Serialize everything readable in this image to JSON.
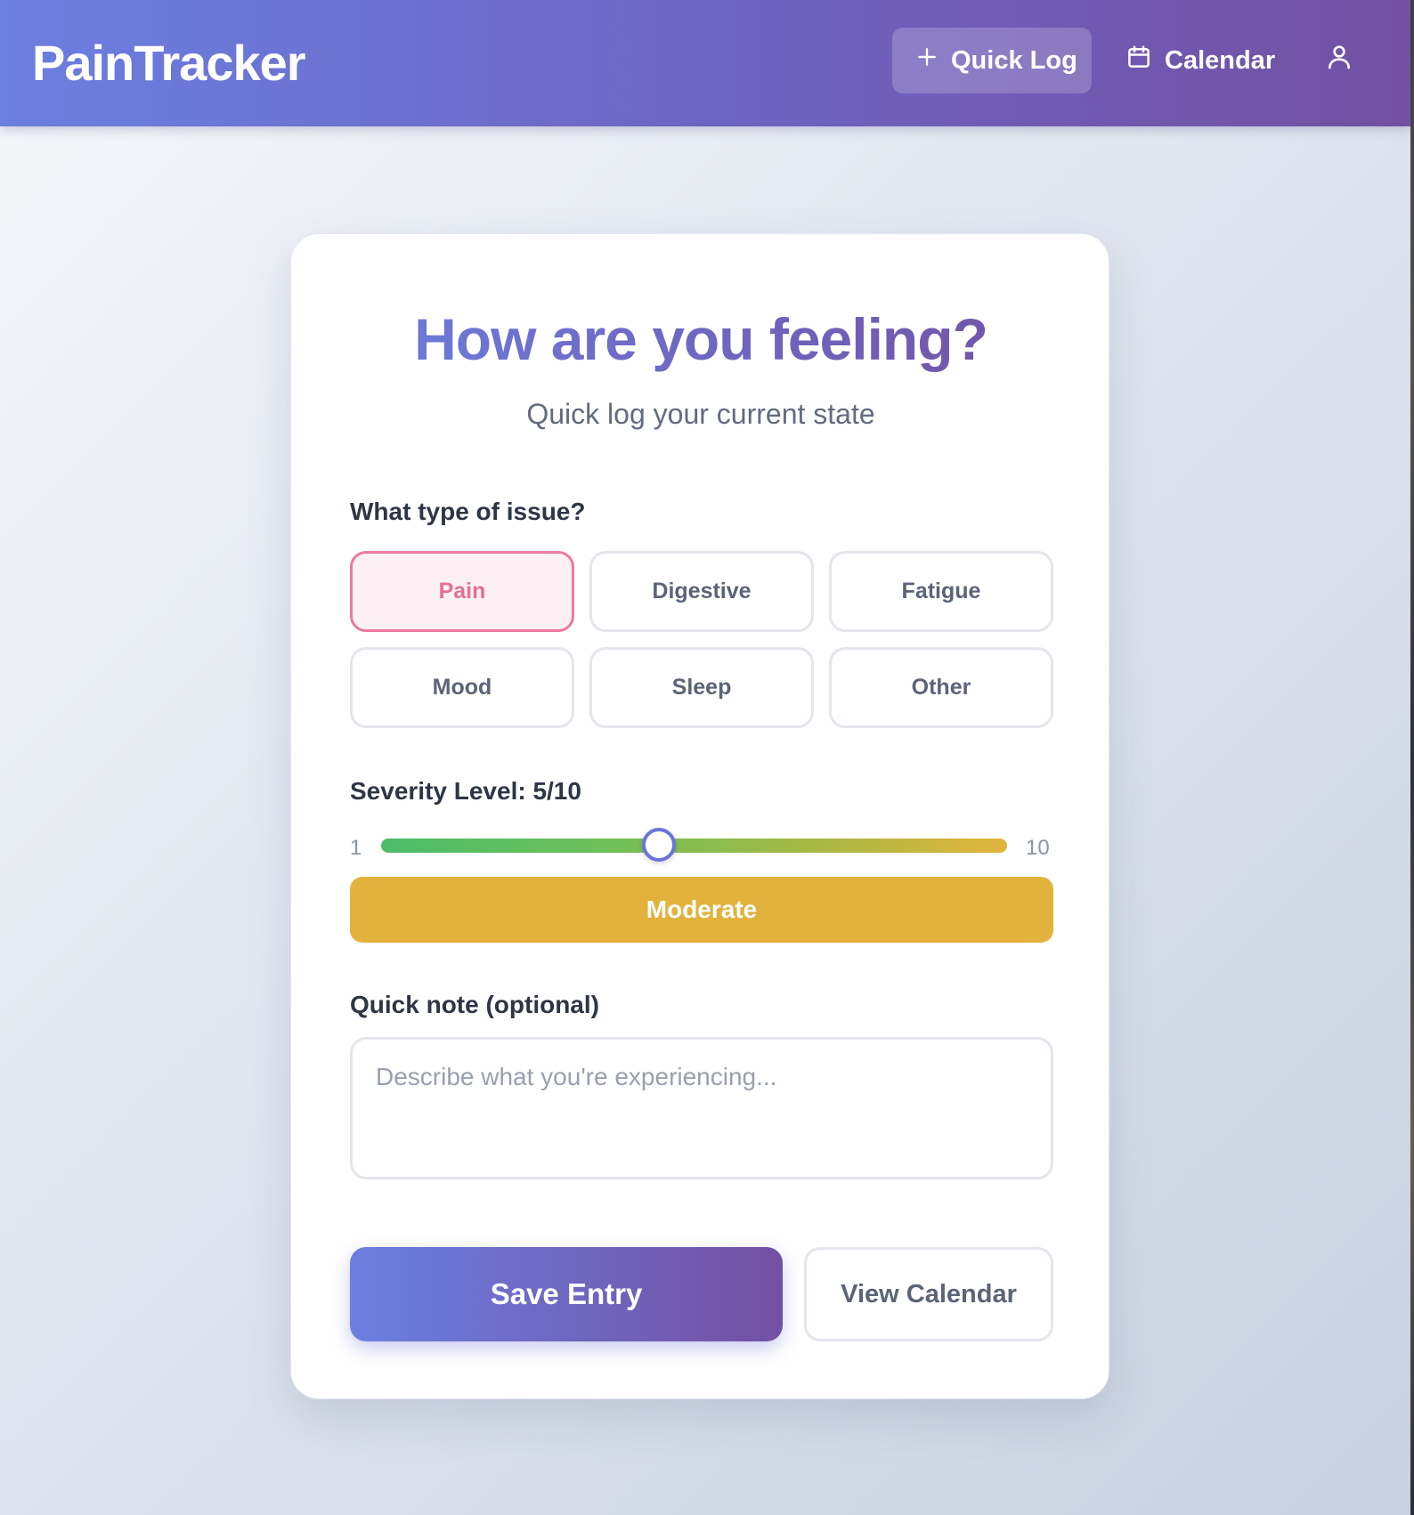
{
  "header": {
    "brand": "PainTracker",
    "nav": {
      "quick_log": "Quick Log",
      "calendar": "Calendar"
    },
    "icons": {
      "quick_log": "plus-icon",
      "calendar": "calendar-icon",
      "profile": "user-icon"
    }
  },
  "form": {
    "title": "How are you feeling?",
    "subtitle": "Quick log your current state",
    "issue_label": "What type of issue?",
    "issue_types": [
      "Pain",
      "Digestive",
      "Fatigue",
      "Mood",
      "Sleep",
      "Other"
    ],
    "selected_issue": "Pain",
    "severity": {
      "label": "Severity Level: 5/10",
      "value": 5,
      "min": 1,
      "max": 10,
      "min_label": "1",
      "max_label": "10",
      "level_text": "Moderate"
    },
    "note": {
      "label": "Quick note (optional)",
      "value": "",
      "placeholder": "Describe what you're experiencing..."
    },
    "save_label": "Save Entry",
    "view_calendar_label": "View Calendar"
  },
  "colors": {
    "primary_start": "#6b7fe0",
    "primary_end": "#7350a2",
    "selected_pink": "#ea7aa0",
    "moderate": "#e2b23c",
    "severity_low": "#4cbc6a",
    "severity_high": "#e2b43d"
  }
}
